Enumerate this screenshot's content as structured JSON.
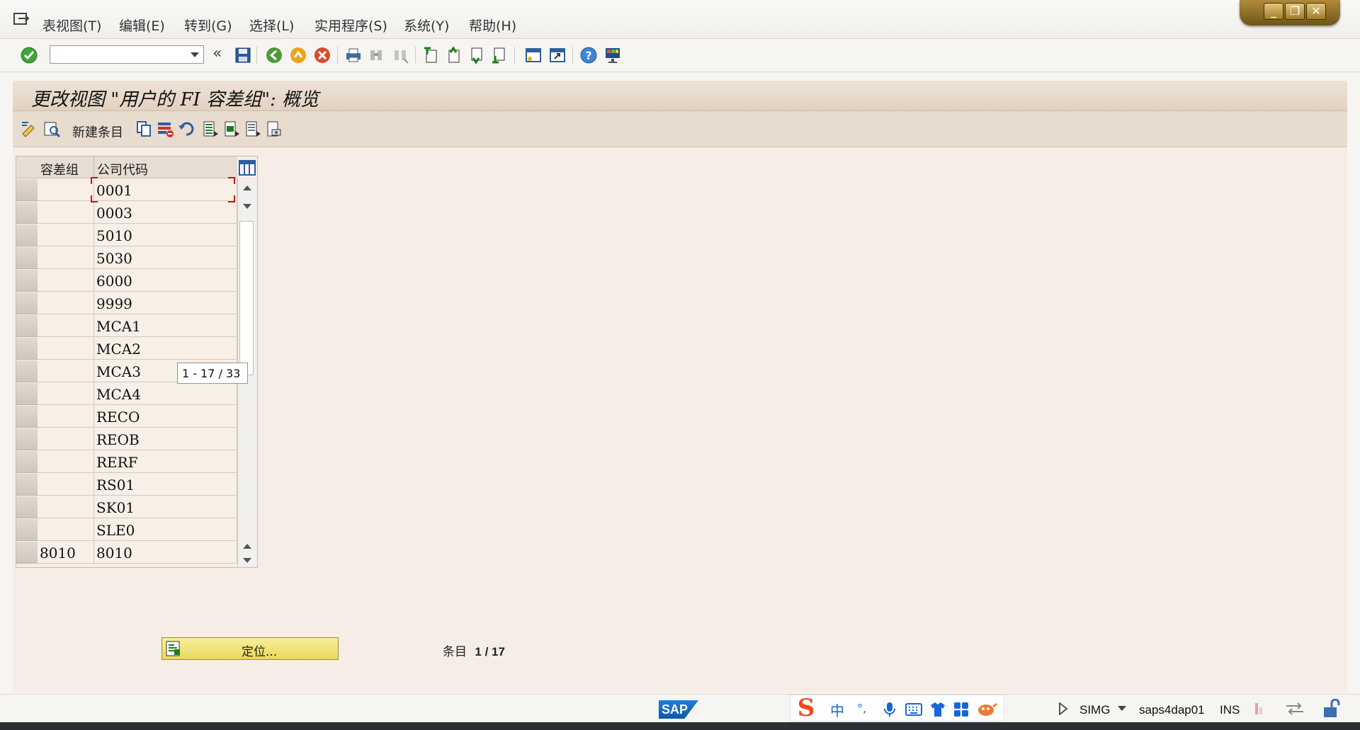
{
  "menu": {
    "items": [
      "表视图(T)",
      "编辑(E)",
      "转到(G)",
      "选择(L)",
      "实用程序(S)",
      "系统(Y)",
      "帮助(H)"
    ]
  },
  "window_controls": {
    "minimize": "_",
    "restore": "❐",
    "close": "✕"
  },
  "toolbar": {
    "command_field_value": "",
    "collapse_glyph": "«"
  },
  "title": "更改视图 \"用户的 FI 容差组\": 概览",
  "app_toolbar": {
    "new_entries_label": "新建条目"
  },
  "table": {
    "columns": [
      "容差组",
      "公司代码"
    ],
    "rows": [
      [
        "",
        "0001"
      ],
      [
        "",
        "0003"
      ],
      [
        "",
        "5010"
      ],
      [
        "",
        "5030"
      ],
      [
        "",
        "6000"
      ],
      [
        "",
        "9999"
      ],
      [
        "",
        "MCA1"
      ],
      [
        "",
        "MCA2"
      ],
      [
        "",
        "MCA3"
      ],
      [
        "",
        "MCA4"
      ],
      [
        "",
        "RECO"
      ],
      [
        "",
        "REOB"
      ],
      [
        "",
        "RERF"
      ],
      [
        "",
        "RS01"
      ],
      [
        "",
        "SK01"
      ],
      [
        "",
        "SLE0"
      ],
      [
        "8010",
        "8010"
      ]
    ],
    "scroll_tooltip": "1 - 17 / 33"
  },
  "footer": {
    "locate_button": "定位...",
    "entry_label": "条目",
    "entry_value": "1 / 17"
  },
  "status_bar": {
    "sap_logo": "SAP",
    "transaction": "SIMG",
    "server": "saps4dap01",
    "mode": "INS"
  },
  "ime": {
    "logo": "S",
    "lang": "中",
    "punct": "°,"
  },
  "colors": {
    "title_bg": "#e6d6c6",
    "app_toolbar_bg": "#e8dccf",
    "content_bg": "#f6eee6",
    "locate_button_bg": "#f1e37b",
    "focus_red": "#c21b1b",
    "window_gold": "#8f6d25"
  }
}
